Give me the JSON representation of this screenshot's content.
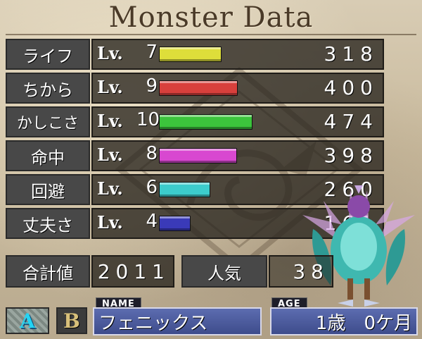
{
  "title": "Monster Data",
  "stats": [
    {
      "label": "ライフ",
      "lv_prefix": "Lv.",
      "level": "7",
      "value": "318",
      "bar_fraction": 0.318,
      "color": "#dede3a"
    },
    {
      "label": "ちから",
      "lv_prefix": "Lv.",
      "level": "9",
      "value": "400",
      "bar_fraction": 0.4,
      "color": "#d8403c"
    },
    {
      "label": "かしこさ",
      "lv_prefix": "Lv.",
      "level": "10",
      "value": "474",
      "bar_fraction": 0.474,
      "color": "#3cc43c"
    },
    {
      "label": "命中",
      "lv_prefix": "Lv.",
      "level": "8",
      "value": "398",
      "bar_fraction": 0.398,
      "color": "#d848d0"
    },
    {
      "label": "回避",
      "lv_prefix": "Lv.",
      "level": "6",
      "value": "260",
      "bar_fraction": 0.26,
      "color": "#3ccccc"
    },
    {
      "label": "丈夫さ",
      "lv_prefix": "Lv.",
      "level": "4",
      "value": "161",
      "bar_fraction": 0.161,
      "color": "#3a3ab8"
    }
  ],
  "totals": {
    "total_label": "合計値",
    "total_value": "2011",
    "popularity_label": "人気",
    "popularity_value": "38"
  },
  "buttons": {
    "a": "A",
    "b": "B"
  },
  "name_tag": "NAME",
  "name_value": "フェニックス",
  "age_tag": "AGE",
  "age_value": "1歳　0ケ月"
}
